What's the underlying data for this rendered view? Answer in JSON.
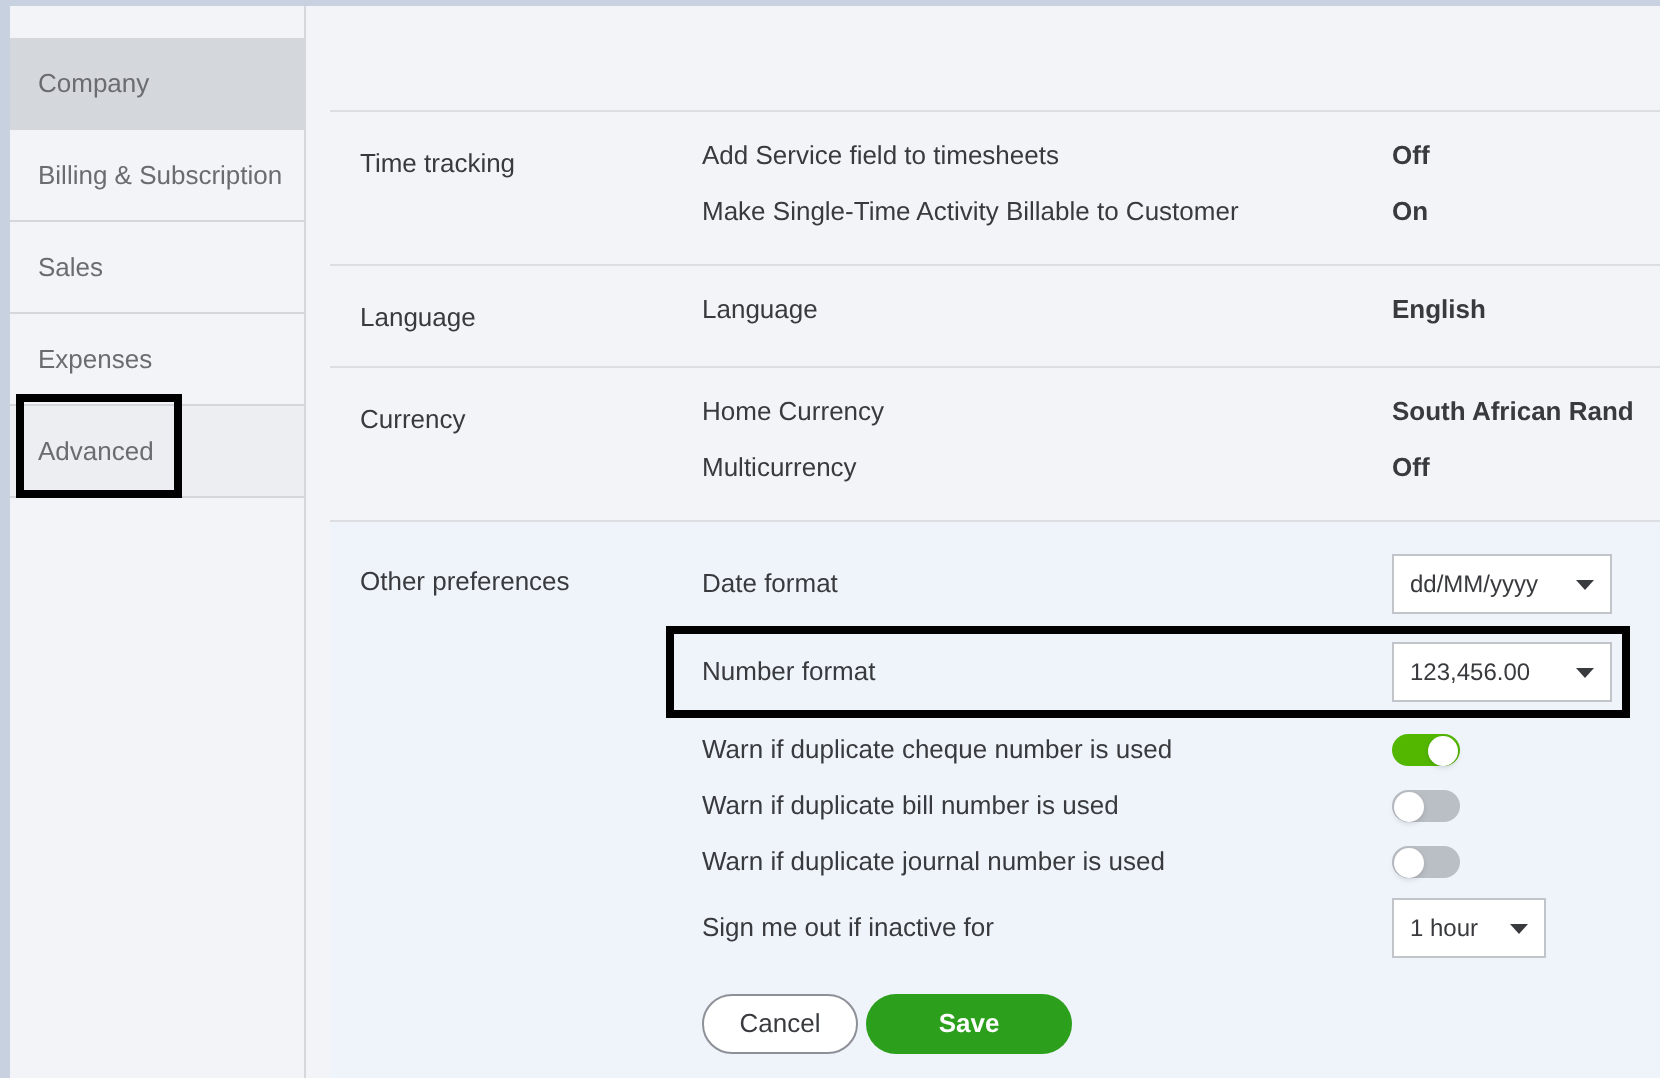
{
  "sidebar": {
    "items": [
      {
        "label": "Company",
        "selected": true,
        "highlighted": false
      },
      {
        "label": "Billing & Subscription",
        "selected": false,
        "highlighted": false
      },
      {
        "label": "Sales",
        "selected": false,
        "highlighted": false
      },
      {
        "label": "Expenses",
        "selected": false,
        "highlighted": false
      },
      {
        "label": "Advanced",
        "selected": false,
        "highlighted": true
      }
    ]
  },
  "sections": [
    {
      "title": "Time tracking",
      "editing": false,
      "rows": [
        {
          "kind": "text",
          "label": "Add Service field to timesheets",
          "value": "Off"
        },
        {
          "kind": "text",
          "label": "Make Single-Time Activity Billable to Customer",
          "value": "On"
        }
      ]
    },
    {
      "title": "Language",
      "editing": false,
      "rows": [
        {
          "kind": "text",
          "label": "Language",
          "value": "English"
        }
      ]
    },
    {
      "title": "Currency",
      "editing": false,
      "rows": [
        {
          "kind": "text",
          "label": "Home Currency",
          "value": "South African Rand"
        },
        {
          "kind": "text",
          "label": "Multicurrency",
          "value": "Off"
        }
      ]
    },
    {
      "title": "Other preferences",
      "editing": true,
      "rows": [
        {
          "kind": "dropdown",
          "label": "Date format",
          "value": "dd/MM/yyyy",
          "highlighted": false,
          "narrow": false
        },
        {
          "kind": "dropdown",
          "label": "Number format",
          "value": "123,456.00",
          "highlighted": true,
          "narrow": false
        },
        {
          "kind": "toggle",
          "label": "Warn if duplicate cheque number is used",
          "on": true
        },
        {
          "kind": "toggle",
          "label": "Warn if duplicate bill number is used",
          "on": false
        },
        {
          "kind": "toggle",
          "label": "Warn if duplicate journal number is used",
          "on": false
        },
        {
          "kind": "dropdown",
          "label": "Sign me out if inactive for",
          "value": "1 hour",
          "highlighted": false,
          "narrow": true
        }
      ],
      "buttons": [
        {
          "kind": "secondary",
          "label": "Cancel"
        },
        {
          "kind": "primary",
          "label": "Save"
        }
      ]
    }
  ]
}
